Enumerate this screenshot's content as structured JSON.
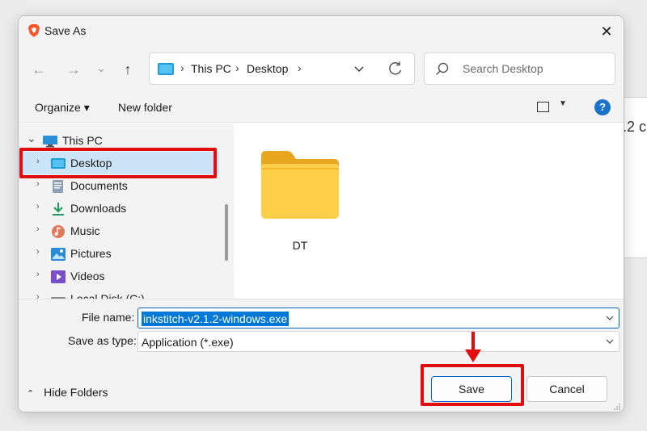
{
  "background_window": {
    "fragment_text": ".2 c"
  },
  "dialog": {
    "title": "Save As",
    "close_glyph": "✕",
    "nav": {
      "back_glyph": "←",
      "forward_glyph": "→",
      "recent_glyph": "⌄",
      "up_glyph": "↑"
    },
    "address": {
      "crumbs": [
        "This PC",
        "Desktop"
      ],
      "separator": "›"
    },
    "search": {
      "placeholder": "Search Desktop"
    },
    "toolbar": {
      "organize_label": "Organize ▾",
      "new_folder_label": "New folder",
      "help_glyph": "?"
    },
    "tree": {
      "root": {
        "label": "This PC",
        "icon": "monitor-icon"
      },
      "items": [
        {
          "label": "Desktop",
          "icon": "desktop-icon",
          "selected": true
        },
        {
          "label": "Documents",
          "icon": "documents-icon"
        },
        {
          "label": "Downloads",
          "icon": "download-icon"
        },
        {
          "label": "Music",
          "icon": "music-icon"
        },
        {
          "label": "Pictures",
          "icon": "pictures-icon"
        },
        {
          "label": "Videos",
          "icon": "videos-icon"
        },
        {
          "label": "Local Disk (C:)",
          "icon": "disk-icon"
        }
      ],
      "chevron_right": "›",
      "chevron_down": "⌄"
    },
    "content": {
      "folders": [
        {
          "name": "DT",
          "icon": "folder-icon"
        }
      ]
    },
    "bottom": {
      "file_name_label": "File name:",
      "file_name_value": "inkstitch-v2.1.2-windows.exe",
      "save_type_label": "Save as type:",
      "save_type_value": "Application (*.exe)",
      "hide_folders_label": "Hide Folders",
      "hide_folders_glyph": "⌃",
      "save_label": "Save",
      "cancel_label": "Cancel"
    }
  },
  "colors": {
    "annotation_red": "#e00d0d",
    "accent_blue": "#0078d7",
    "selection_bg": "#cce4f7"
  }
}
